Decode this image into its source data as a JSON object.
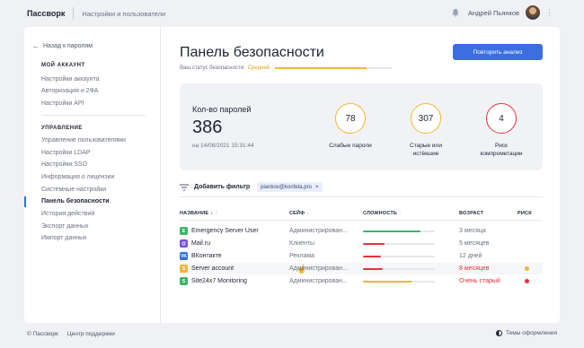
{
  "topbar": {
    "logo": "Пассворк",
    "section": "Настройки и пользователи",
    "user_name": "Андрей Пьянков",
    "kebab": "⋮"
  },
  "sidebar": {
    "back_label": "Назад к паролям",
    "account_title": "МОЙ АККАУНТ",
    "account_items": [
      "Настройки аккаунта",
      "Авторизация и 2ФА",
      "Настройки API"
    ],
    "admin_title": "УПРАВЛЕНИЕ",
    "admin_items": [
      "Управление пользователями",
      "Настройки LDAP",
      "Настройки SSO",
      "Информация о лицензии",
      "Системные настройки",
      "Панель безопасности",
      "История действий",
      "Экспорт данных",
      "Импорт данных"
    ],
    "active_item": "Панель безопасности"
  },
  "main": {
    "title": "Панель безопасности",
    "status_label": "Ваш статус безопасности:",
    "status_value": "Средний",
    "status_progress": 0.78,
    "check_button": "Повторить анализ"
  },
  "stats": {
    "count_label": "Кол-во паролей",
    "count": "386",
    "date": "на 14/08/2021 15:31:44",
    "metrics": [
      {
        "value": "78",
        "label": "Слабые пароли",
        "color": "#f4b633"
      },
      {
        "value": "307",
        "label": "Старые или истёкшие",
        "color": "#f4b633"
      },
      {
        "value": "4",
        "label": "Риск компрометации",
        "color": "#e5323b"
      }
    ]
  },
  "filter": {
    "label": "Добавить фильтр",
    "chip": "piankov@konfeta.pro",
    "chip_close": "×"
  },
  "table": {
    "columns": [
      "НАЗВАНИЕ",
      "СЕЙФ",
      "СЛОЖНОСТЬ",
      "ВОЗРАСТ",
      "РИСК"
    ],
    "rows": [
      {
        "name": "Emergency Server User",
        "icon": "E",
        "icon_color": "#3db36b",
        "safe": "Администрирован...",
        "complexity": 0.8,
        "complexity_color": "#3db36b",
        "age": "3 месяца",
        "age_alert": false,
        "risk": ""
      },
      {
        "name": "Mail.ru",
        "icon": "@",
        "icon_color": "#7b4fd6",
        "safe": "Клиенты",
        "complexity": 0.3,
        "complexity_color": "#e5323b",
        "age": "5 месяцев",
        "age_alert": false,
        "risk": ""
      },
      {
        "name": "ВКонтакте",
        "icon": "VK",
        "icon_color": "#2f6fe0",
        "safe": "Реклама",
        "complexity": 0.25,
        "complexity_color": "#e5323b",
        "age": "12 дней",
        "age_alert": false,
        "risk": ""
      },
      {
        "name": "Server account",
        "icon": "S",
        "icon_color": "#f4b633",
        "safe": "Администрирован...",
        "complexity": 0.28,
        "complexity_color": "#e5323b",
        "age": "8 месяцев",
        "age_alert": true,
        "risk": "#f4b633"
      },
      {
        "name": "Site24x7 Monitoring",
        "icon": "S",
        "icon_color": "#3db36b",
        "safe": "Администрирован...",
        "complexity": 0.68,
        "complexity_color": "#f4b633",
        "age": "Очень старый",
        "age_alert": true,
        "risk": "#e5323b"
      }
    ]
  },
  "footer": {
    "copyright": "© Пассворк",
    "support": "Центр поддержки",
    "theme": "Темы оформления"
  }
}
